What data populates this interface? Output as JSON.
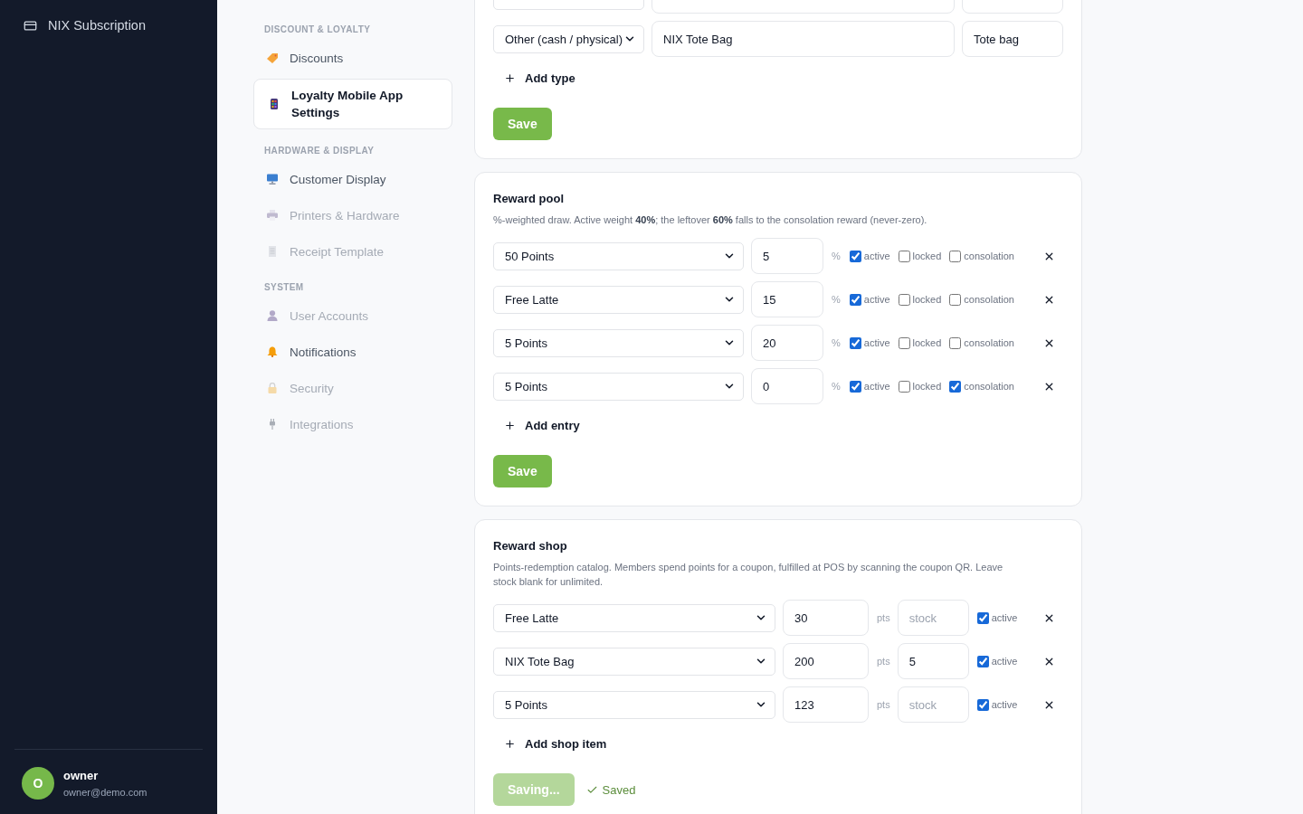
{
  "app_sidebar": {
    "title": "NIX Subscription",
    "user": {
      "initial": "O",
      "name": "owner",
      "email": "owner@demo.com"
    }
  },
  "settings_nav": {
    "sections": [
      {
        "heading": "DISCOUNT & LOYALTY",
        "items": [
          {
            "label": "Discounts",
            "selected": false,
            "disabled": false
          },
          {
            "label": "Loyalty Mobile App Settings",
            "selected": true,
            "disabled": false
          }
        ]
      },
      {
        "heading": "HARDWARE & DISPLAY",
        "items": [
          {
            "label": "Customer Display",
            "selected": false,
            "disabled": false
          },
          {
            "label": "Printers & Hardware",
            "selected": false,
            "disabled": true
          },
          {
            "label": "Receipt Template",
            "selected": false,
            "disabled": true
          }
        ]
      },
      {
        "heading": "SYSTEM",
        "items": [
          {
            "label": "User Accounts",
            "selected": false,
            "disabled": true
          },
          {
            "label": "Notifications",
            "selected": false,
            "disabled": false
          },
          {
            "label": "Security",
            "selected": false,
            "disabled": true
          },
          {
            "label": "Integrations",
            "selected": false,
            "disabled": true
          }
        ]
      }
    ]
  },
  "reward_types": {
    "rows": [
      {},
      {
        "type": "Other (cash / physical)",
        "name": "NIX Tote Bag",
        "label": "Tote bag"
      }
    ],
    "add_button": "Add type",
    "save_button": {
      "label": "Save",
      "disabled": false
    }
  },
  "reward_pool": {
    "title": "Reward pool",
    "description": "%-weighted draw. Active weight **40%**; the leftover **60%** falls to the consolation reward (never-zero).",
    "rows": [
      {
        "reward": "50 Points",
        "weight": "5",
        "unit": "%",
        "active": true,
        "active_label": "active",
        "locked": false,
        "locked_label": "locked",
        "consolation": false,
        "consolation_label": "consolation"
      },
      {
        "reward": "Free Latte",
        "weight": "15",
        "unit": "%",
        "active": true,
        "active_label": "active",
        "locked": false,
        "locked_label": "locked",
        "consolation": false,
        "consolation_label": "consolation"
      },
      {
        "reward": "5 Points",
        "weight": "20",
        "unit": "%",
        "active": true,
        "active_label": "active",
        "locked": false,
        "locked_label": "locked",
        "consolation": false,
        "consolation_label": "consolation"
      },
      {
        "reward": "5 Points",
        "weight": "0",
        "unit": "%",
        "active": true,
        "active_label": "active",
        "locked": false,
        "locked_label": "locked",
        "consolation": true,
        "consolation_label": "consolation"
      }
    ],
    "add_button": "Add entry",
    "save_button": {
      "label": "Save",
      "disabled": false
    }
  },
  "reward_shop": {
    "title": "Reward shop",
    "description": "Points-redemption catalog. Members spend points for a coupon, fulfilled at POS by scanning the coupon QR. Leave stock blank for unlimited.",
    "rows": [
      {
        "reward": "Free Latte",
        "points": "30",
        "unit": "pts",
        "stock": {
          "placeholder": "stock"
        },
        "active": true,
        "active_label": "active"
      },
      {
        "reward": "NIX Tote Bag",
        "points": "200",
        "unit": "pts",
        "stock": {
          "value": "5"
        },
        "active": true,
        "active_label": "active"
      },
      {
        "reward": "5 Points",
        "points": "123",
        "unit": "pts",
        "stock": {
          "placeholder": "stock"
        },
        "active": true,
        "active_label": "active"
      }
    ],
    "add_button": "Add shop item",
    "save_button": {
      "label": "Saving...",
      "disabled": true
    },
    "status": "Saved"
  }
}
